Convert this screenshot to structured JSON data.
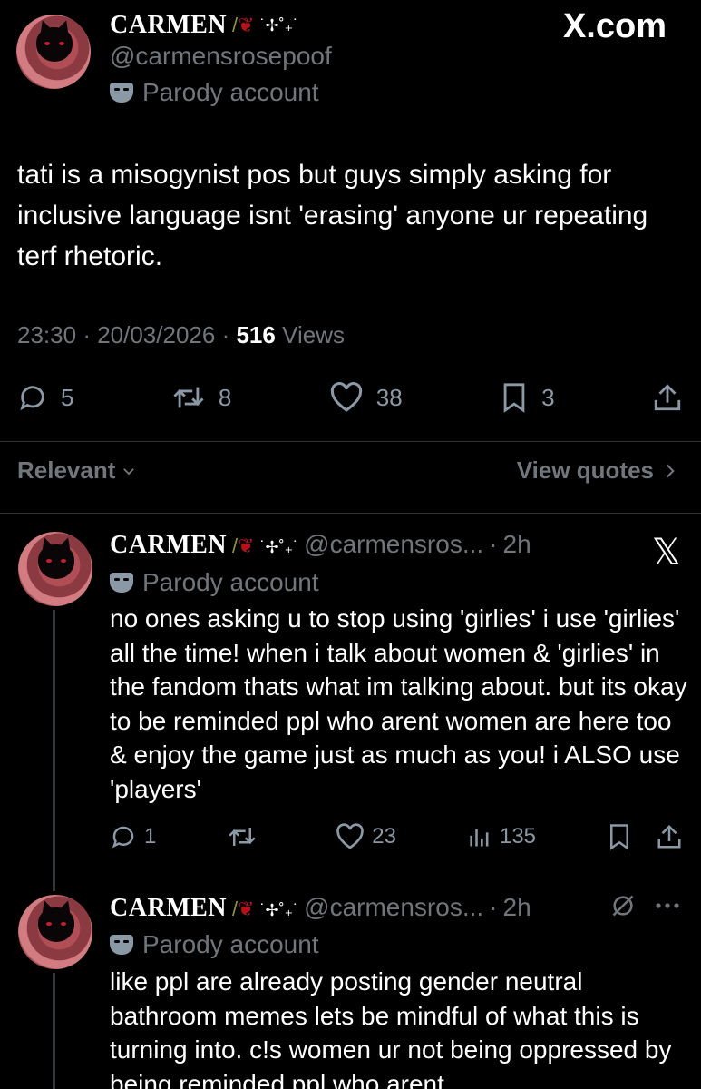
{
  "brand": {
    "site": "X.com"
  },
  "main_tweet": {
    "display_name": "CARMEN",
    "decoration": "˙✢˚₊˙",
    "handle": "@carmensrosepoof",
    "parody_label": "Parody account",
    "text": "tati is a misogynist pos but guys simply asking for inclusive language isnt 'erasing' anyone ur repeating terf rhetoric.",
    "time": "23:30",
    "date": "20/03/2026",
    "views_count": "516",
    "views_label": "Views",
    "replies": "5",
    "reposts": "8",
    "likes": "38",
    "bookmarks": "3"
  },
  "sort": {
    "relevant_label": "Relevant",
    "view_quotes_label": "View quotes"
  },
  "replies": [
    {
      "display_name": "CARMEN",
      "decoration": "˙✢˚₊˙",
      "handle": "@carmensros...",
      "age": "2h",
      "parody_label": "Parody account",
      "text": "no ones asking u to stop using 'girlies' i use 'girlies' all the time! when i talk about women & 'girlies' in the fandom thats what im talking about. but its okay to be reminded ppl who arent women are here too & enjoy the game just as much as you! i ALSO use 'players'",
      "replies": "1",
      "reposts": "",
      "likes": "23",
      "views": "135"
    },
    {
      "display_name": "CARMEN",
      "decoration": "˙✢˚₊˙",
      "handle": "@carmensros...",
      "age": "2h",
      "parody_label": "Parody account",
      "text": "like ppl are already posting gender neutral bathroom memes lets be mindful of what this is turning into. c!s women ur not being oppressed by being reminded ppl who arent"
    }
  ],
  "icons": {
    "reply": "speech-bubble-icon",
    "repost": "repost-arrows-icon",
    "like": "heart-icon",
    "bookmark": "bookmark-icon",
    "share": "share-upload-icon",
    "views": "bar-chart-icon",
    "grok": "grok-slash-icon",
    "more": "ellipsis-icon",
    "x_logo": "x-logo-icon"
  },
  "colors": {
    "background": "#000000",
    "text": "#ffffff",
    "muted": "#71767b",
    "rose": "#b5121b"
  }
}
